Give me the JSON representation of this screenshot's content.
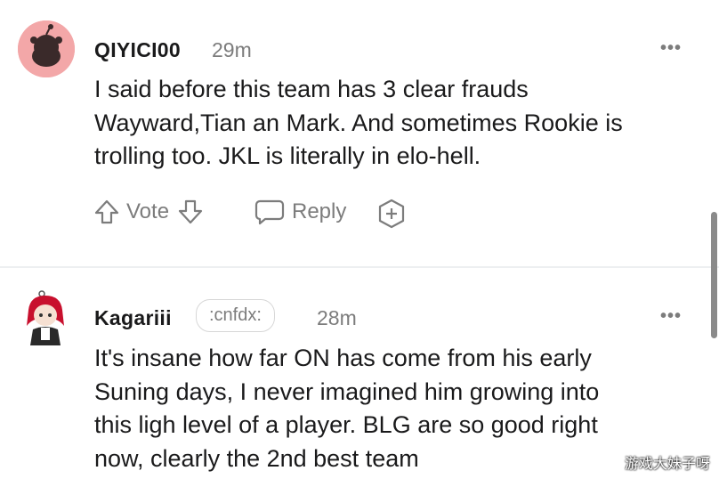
{
  "comments": [
    {
      "username": "QIYICI00",
      "time": "29m",
      "body_lines": [
        "I said before this team has 3 clear frauds",
        "Wayward,Tian an Mark. And sometimes Rookie is",
        "trolling too. JKL is literally in elo-hell."
      ],
      "actions": {
        "vote_label": "Vote",
        "reply_label": "Reply"
      },
      "more_label": "•••"
    },
    {
      "username": "Kagariii",
      "flair": ":cnfdx:",
      "time": "28m",
      "body_lines": [
        "It's insane how far ON has come from his early",
        "Suning days, I never imagined him growing into",
        "this ligh level of a player. BLG are so good right",
        "now, clearly the 2nd best team"
      ],
      "more_label": "•••"
    }
  ],
  "watermark": "游戏大妹子呀",
  "colors": {
    "avatar_bg": "#f3a7a8",
    "meta_gray": "#7c7c7c",
    "text": "#1a1a1b",
    "divider": "#edeff1"
  }
}
